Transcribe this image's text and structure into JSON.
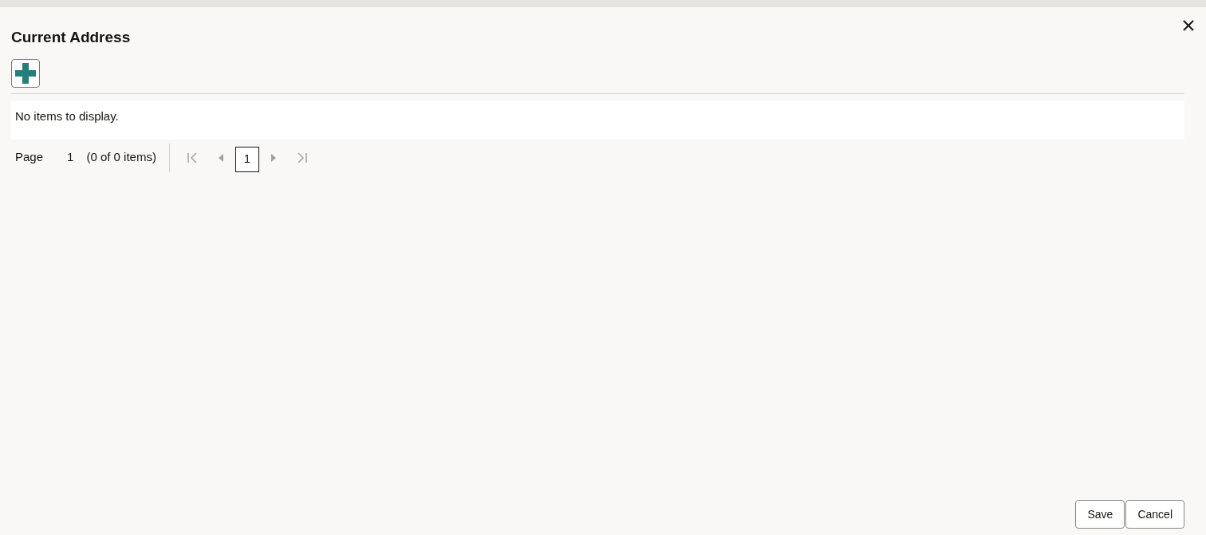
{
  "dialog": {
    "title": "Current Address"
  },
  "table": {
    "empty_message": "No items to display."
  },
  "pager": {
    "label": "Page",
    "page": "1",
    "range": "(0 of 0 items)",
    "current_page": "1"
  },
  "buttons": [
    "Save",
    "Cancel"
  ]
}
